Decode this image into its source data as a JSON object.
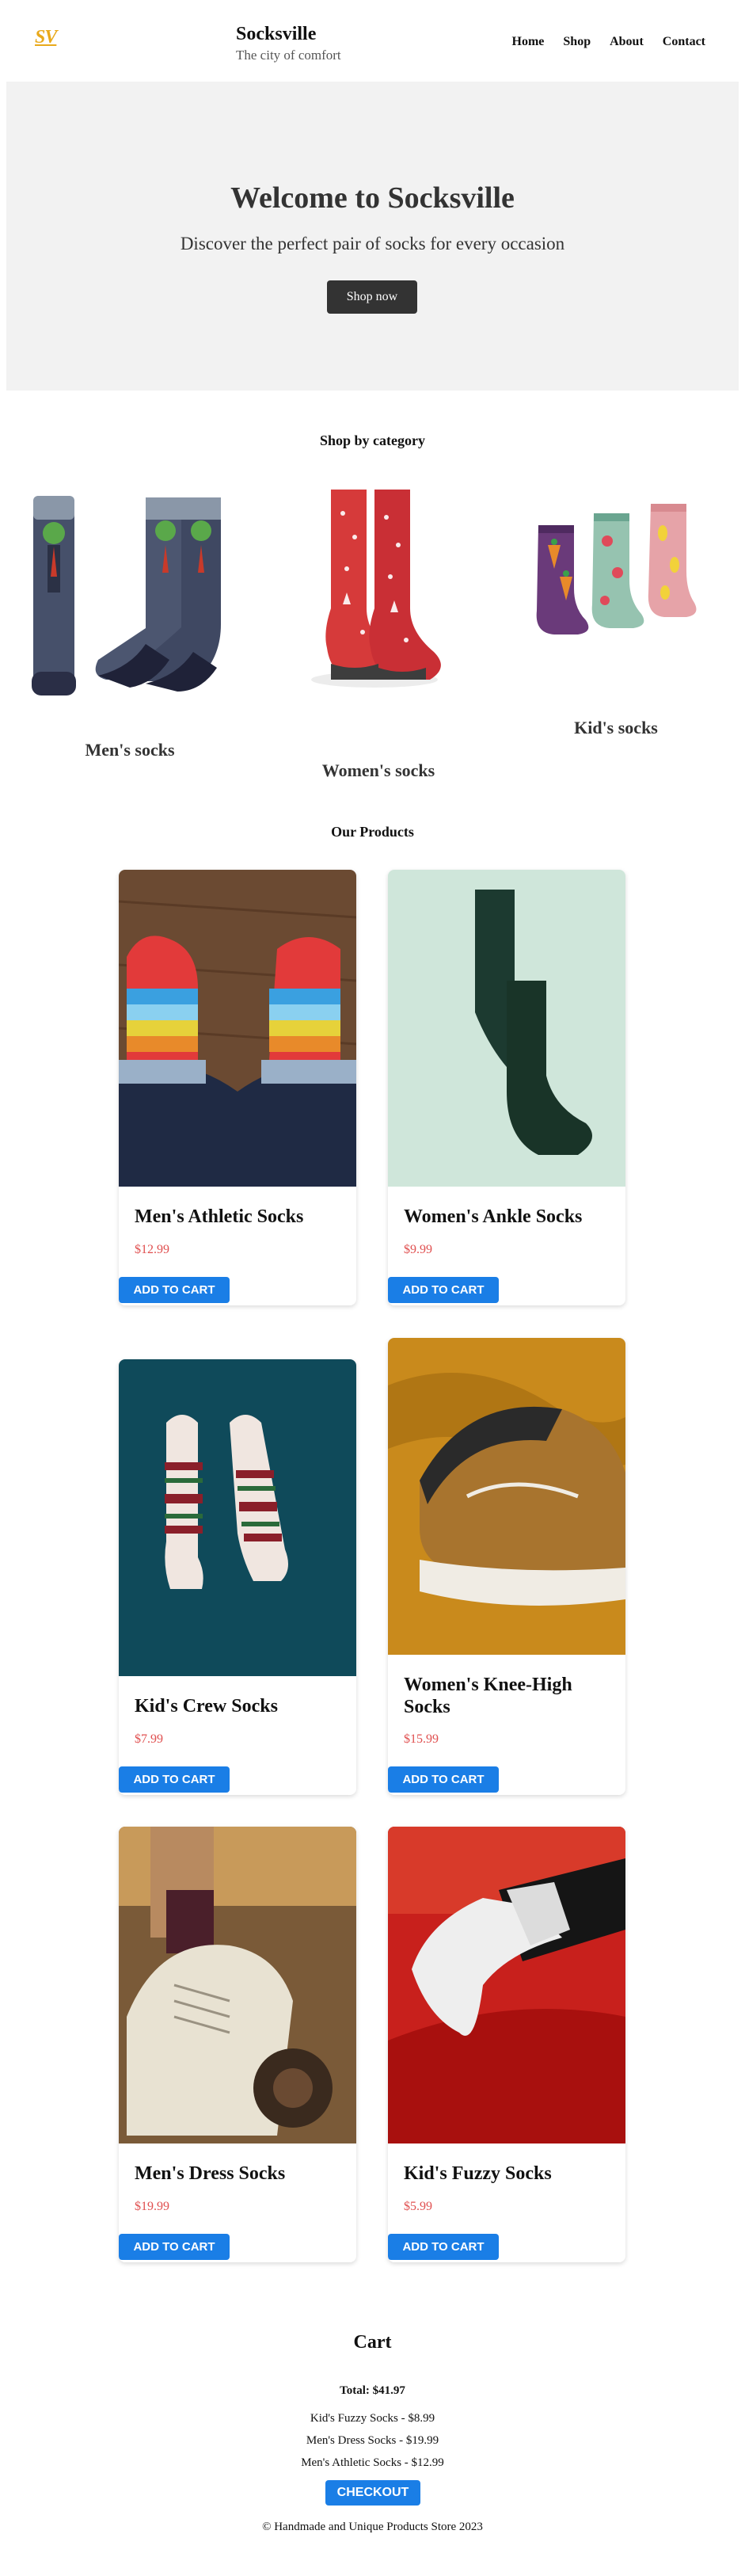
{
  "header": {
    "logo": "SV",
    "title": "Socksville",
    "subtitle": "The city of comfort",
    "nav": [
      "Home",
      "Shop",
      "About",
      "Contact"
    ]
  },
  "hero": {
    "title": "Welcome to Socksville",
    "subtitle": "Discover the perfect pair of socks for every occasion",
    "button": "Shop now"
  },
  "categories": {
    "heading": "Shop by category",
    "items": [
      {
        "label": "Men's socks"
      },
      {
        "label": "Women's socks"
      },
      {
        "label": "Kid's socks"
      }
    ]
  },
  "products": {
    "heading": "Our Products",
    "button_label": "ADD TO CART",
    "items": [
      {
        "name": "Men's Athletic Socks",
        "price": "$12.99"
      },
      {
        "name": "Women's Ankle Socks",
        "price": "$9.99"
      },
      {
        "name": "Kid's Crew Socks",
        "price": "$7.99"
      },
      {
        "name": "Women's Knee-High Socks",
        "price": "$15.99"
      },
      {
        "name": "Men's Dress Socks",
        "price": "$19.99"
      },
      {
        "name": "Kid's Fuzzy Socks",
        "price": "$5.99"
      }
    ]
  },
  "cart": {
    "title": "Cart",
    "total": "Total: $41.97",
    "items": [
      "Kid's Fuzzy Socks - $8.99",
      "Men's Dress Socks - $19.99",
      "Men's Athletic Socks - $12.99"
    ],
    "checkout": "CHECKOUT"
  },
  "footer": {
    "text": "© Handmade and Unique Products Store 2023"
  },
  "colors": {
    "accent": "#1a7ee6",
    "price": "#e05050",
    "logo": "#e9a91b",
    "hero_bg": "#f2f2f2"
  }
}
